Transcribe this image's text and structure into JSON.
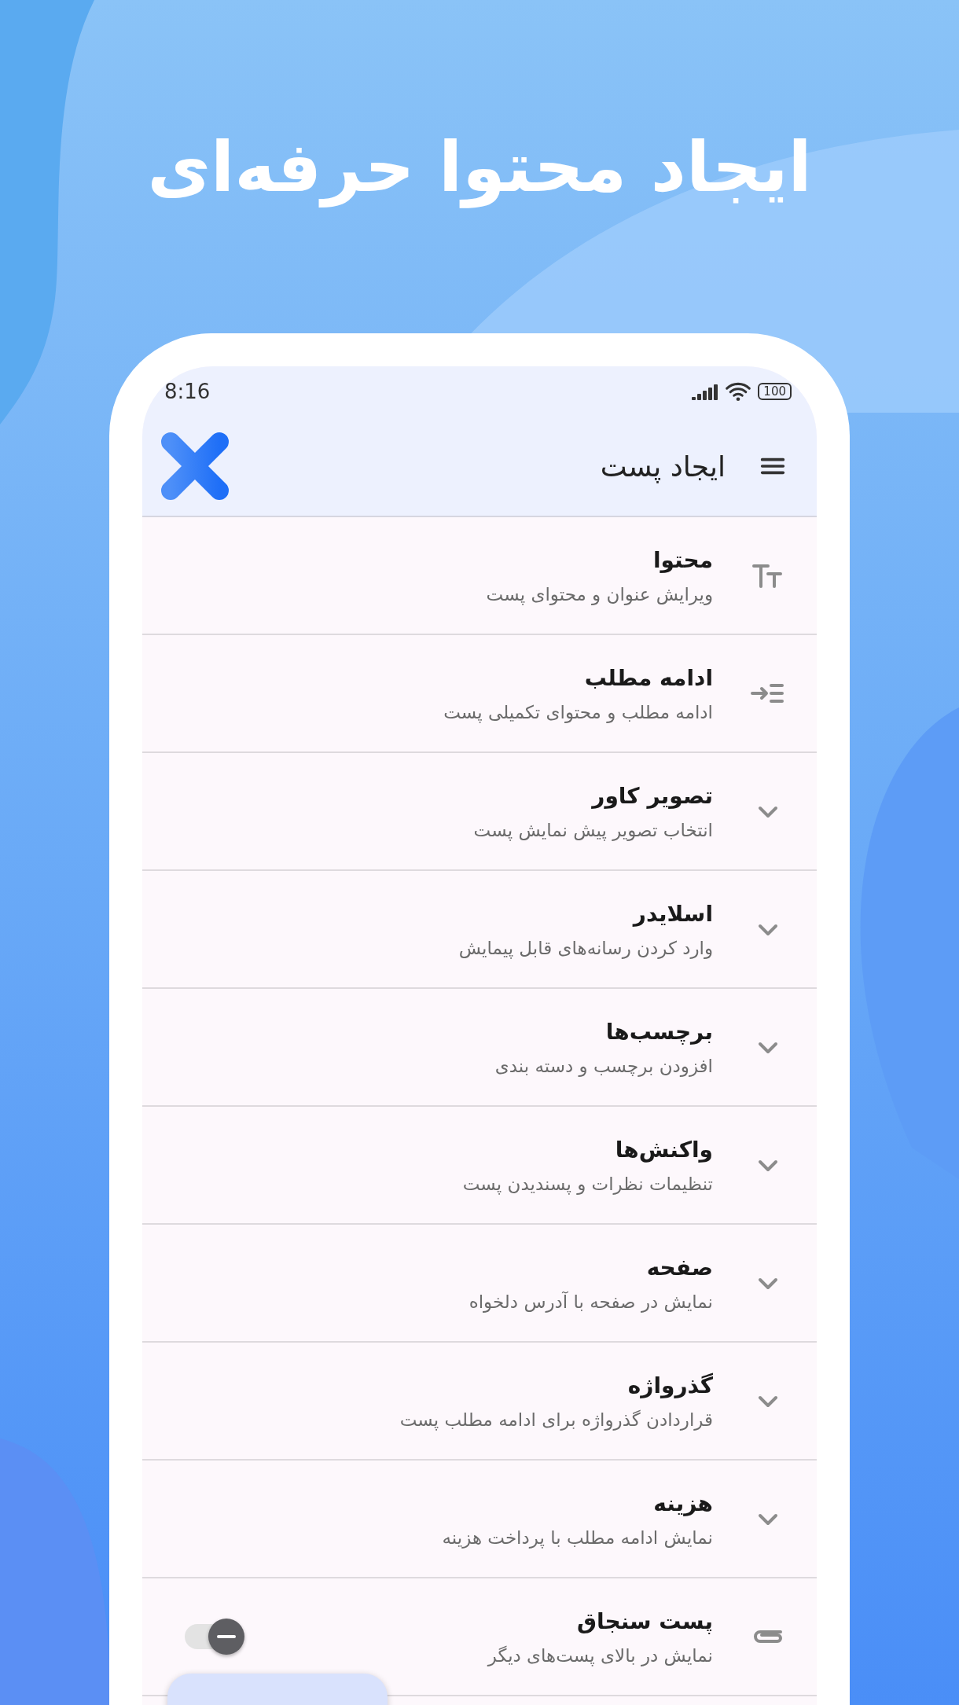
{
  "headline": "ایجاد محتوا حرفه‌ای",
  "status_bar": {
    "time": "8:16",
    "battery": "100"
  },
  "app_bar": {
    "title": "ایجاد پست"
  },
  "rows": [
    {
      "kind": "text",
      "title": "محتوا",
      "subtitle": "ویرایش عنوان و محتوای پست"
    },
    {
      "kind": "indent",
      "title": "ادامه مطلب",
      "subtitle": "ادامه مطلب و محتوای تکمیلی پست"
    },
    {
      "kind": "expand",
      "title": "تصویر کاور",
      "subtitle": "انتخاب تصویر پیش نمایش پست",
      "expanded": false
    },
    {
      "kind": "expand",
      "title": "اسلایدر",
      "subtitle": "وارد کردن رسانه‌های قابل پیمایش",
      "expanded": false
    },
    {
      "kind": "expand",
      "title": "برچسب‌ها",
      "subtitle": "افزودن برچسب و دسته بندی",
      "expanded": false
    },
    {
      "kind": "expand",
      "title": "واکنش‌ها",
      "subtitle": "تنظیمات نظرات و پسندیدن پست",
      "expanded": false
    },
    {
      "kind": "expand",
      "title": "صفحه",
      "subtitle": "نمایش در صفحه با آدرس دلخواه",
      "expanded": false
    },
    {
      "kind": "expand",
      "title": "گذرواژه",
      "subtitle": "قراردادن گذرواژه برای ادامه مطلب پست",
      "expanded": false
    },
    {
      "kind": "expand",
      "title": "هزینه",
      "subtitle": "نمایش ادامه مطلب با پرداخت هزینه",
      "expanded": false
    },
    {
      "kind": "toggle",
      "title": "پست سنجاق",
      "subtitle": "نمایش در بالای پست‌های دیگر",
      "on": false
    }
  ]
}
